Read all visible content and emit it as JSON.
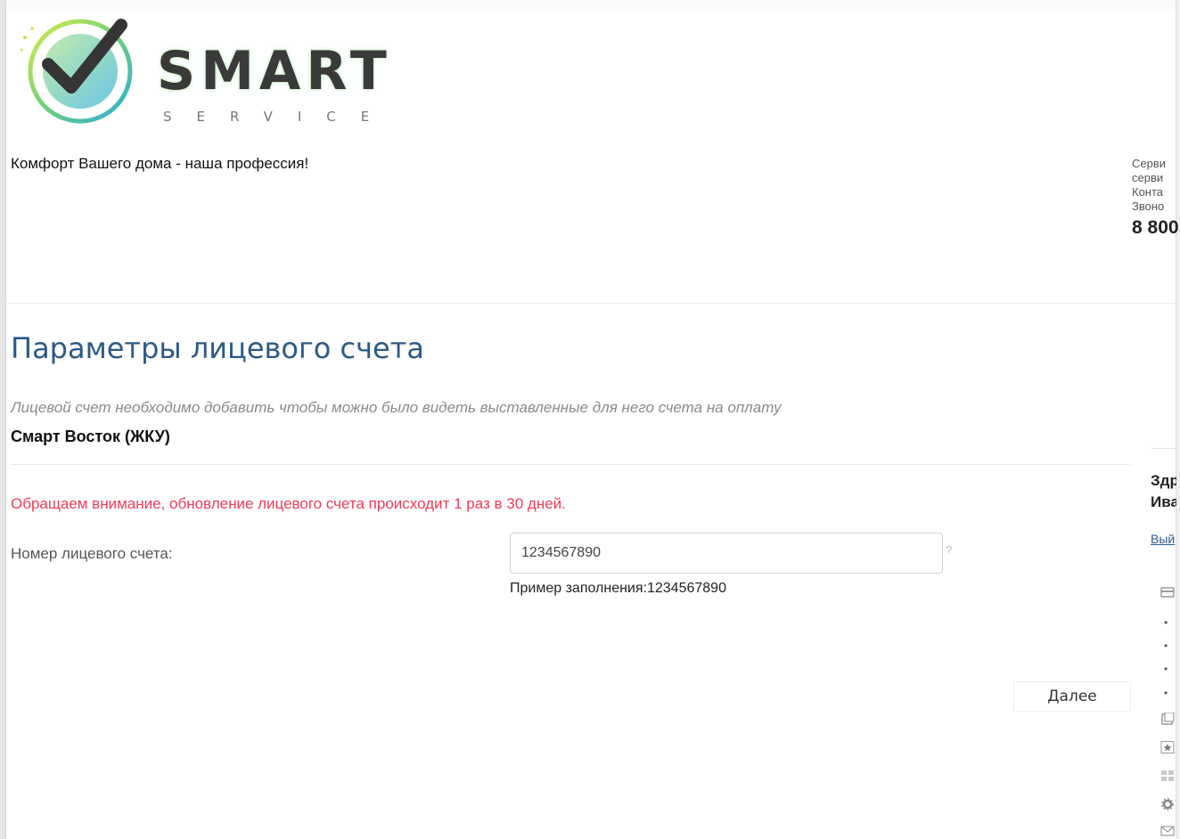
{
  "header": {
    "logo": {
      "word": "SMART",
      "sub": "SERVICE"
    },
    "tagline": "Комфорт Вашего дома - наша профессия!",
    "contact": {
      "line1": "Серви",
      "line2": "серви",
      "line3": "Конта",
      "line4": "Звоно",
      "phone": "8 800"
    }
  },
  "main": {
    "title": "Параметры лицевого счета",
    "hint": "Лицевой счет необходимо добавить чтобы можно было видеть выставленные для него счета на оплату",
    "provider": "Смарт Восток (ЖКУ)",
    "warning": "Обращаем внимание, обновление лицевого счета происходит 1 раз в 30 дней.",
    "account_label": "Номер лицевого счета:",
    "account_value": "1234567890",
    "help_glyph": "?",
    "example": "Пример заполнения:1234567890",
    "next_button": "Далее"
  },
  "sidebar": {
    "greet_line1": "Здр",
    "greet_line2": "Ива",
    "logout": "Вый",
    "icons": [
      "card-icon",
      "document-icon",
      "star-icon",
      "grid-icon",
      "gear-icon",
      "mail-icon"
    ]
  }
}
